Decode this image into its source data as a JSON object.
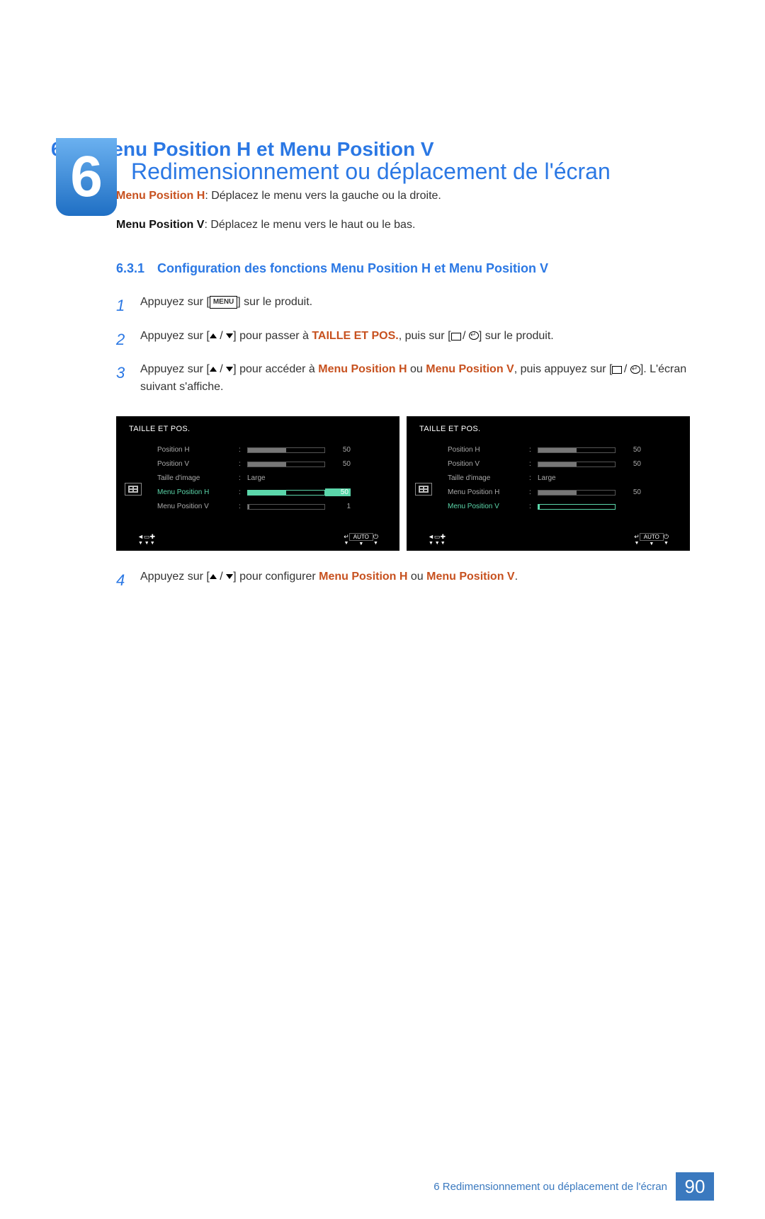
{
  "chapter": {
    "num": "6",
    "title": "Redimensionnement ou déplacement de l'écran"
  },
  "section": {
    "num": "6.3",
    "title": "Menu Position H et Menu Position V"
  },
  "intro": {
    "h_label": "Menu Position H",
    "h_text": ": Déplacez le menu vers la gauche ou la droite.",
    "v_label": "Menu Position V",
    "v_text": ": Déplacez le menu vers le haut ou le bas."
  },
  "subsection": {
    "num": "6.3.1",
    "title": "Configuration des fonctions Menu Position H et Menu Position V"
  },
  "steps": {
    "s1_a": "Appuyez sur [",
    "s1_menu": "MENU",
    "s1_b": "] sur le produit.",
    "s2_a": "Appuyez sur [",
    "s2_b": "] pour passer à ",
    "s2_accent": "TAILLE ET POS.",
    "s2_c": ", puis sur [",
    "s2_d": "] sur le produit.",
    "s3_a": "Appuyez sur [",
    "s3_b": "] pour accéder à ",
    "s3_accent1": "Menu Position H",
    "s3_mid": " ou ",
    "s3_accent2": "Menu Position V",
    "s3_c": ", puis appuyez sur [",
    "s3_d": "]. L'écran suivant s'affiche.",
    "s4_a": "Appuyez sur [",
    "s4_b": "] pour configurer ",
    "s4_accent1": "Menu Position H",
    "s4_mid": " ou ",
    "s4_accent2": "Menu Position V",
    "s4_c": "."
  },
  "osd_common": {
    "title": "TAILLE ET POS.",
    "nav_auto": "AUTO",
    "items": {
      "posH": "Position H",
      "posV": "Position V",
      "taille": "Taille d'image",
      "tailleVal": "Large",
      "menuH": "Menu Position H",
      "menuV": "Menu Position V"
    },
    "values": {
      "posH": "50",
      "posV": "50",
      "menuH": "50",
      "menuV": "1"
    }
  },
  "footer": {
    "text": "6 Redimensionnement ou déplacement de l'écran",
    "page": "90"
  }
}
